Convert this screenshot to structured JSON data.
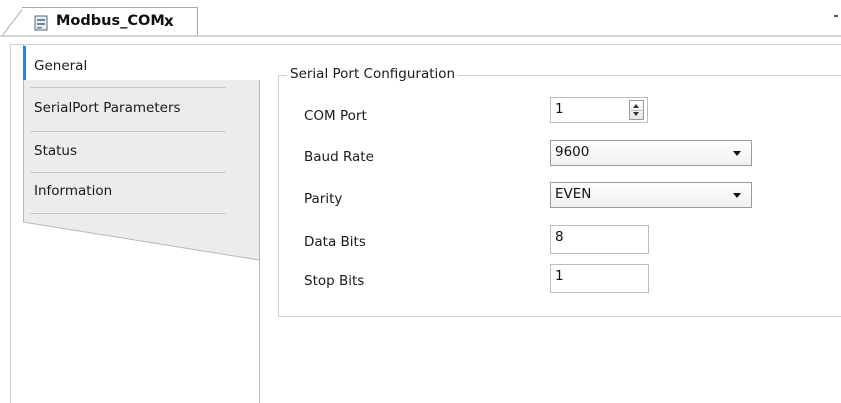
{
  "editor_tab": {
    "title": "Modbus_COM",
    "close_glyph": "x",
    "icon": "device-document-icon"
  },
  "navigation": {
    "items": [
      {
        "label": "General",
        "selected": true
      },
      {
        "label": "SerialPort Parameters",
        "selected": false
      },
      {
        "label": "Status",
        "selected": false
      },
      {
        "label": "Information",
        "selected": false
      }
    ]
  },
  "serial_config": {
    "group_title": "Serial Port Configuration",
    "com_port": {
      "label": "COM Port",
      "value": "1"
    },
    "baud_rate": {
      "label": "Baud Rate",
      "value": "9600"
    },
    "parity": {
      "label": "Parity",
      "value": "EVEN"
    },
    "data_bits": {
      "label": "Data Bits",
      "value": "8"
    },
    "stop_bits": {
      "label": "Stop Bits",
      "value": "1"
    }
  },
  "colors": {
    "accent": "#2f7ed8",
    "panel_gray": "#ececec",
    "border": "#a9a9a9"
  }
}
